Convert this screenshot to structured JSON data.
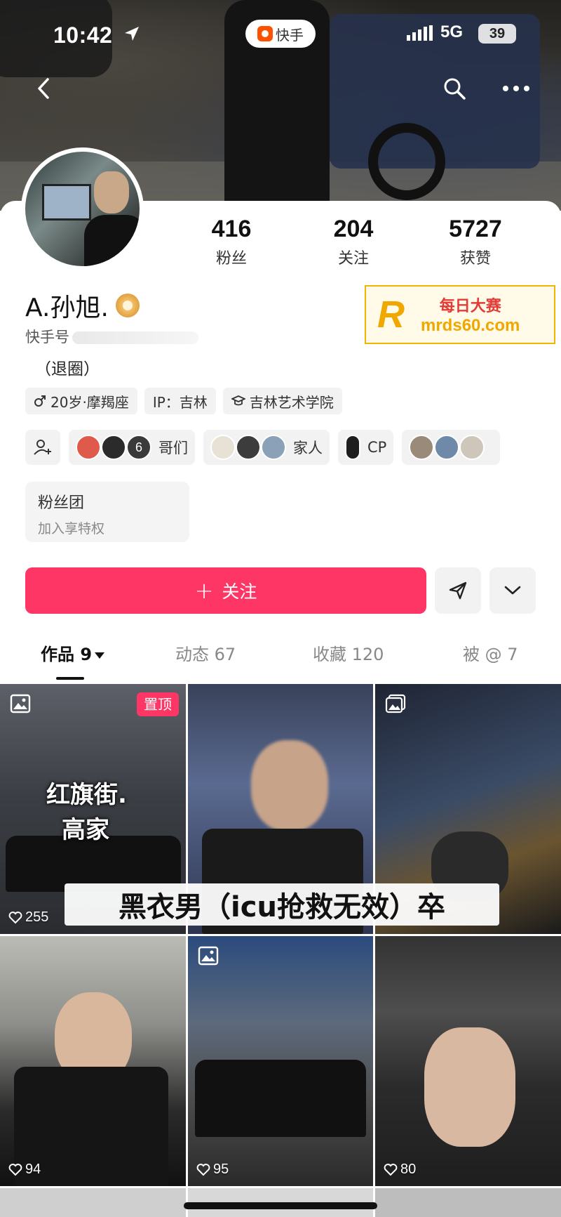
{
  "status_bar": {
    "time": "10:42",
    "app_pill": "快手",
    "network": "5G",
    "battery": "39"
  },
  "header": {
    "icons": [
      "back-icon",
      "search-icon",
      "more-icon"
    ]
  },
  "profile": {
    "name": "A.孙旭.",
    "kuaishou_id_label": "快手号",
    "bio": "（退圈）",
    "stats": [
      {
        "value": "416",
        "label": "粉丝"
      },
      {
        "value": "204",
        "label": "关注"
      },
      {
        "value": "5727",
        "label": "获赞"
      }
    ],
    "tags": {
      "age": "20岁·摩羯座",
      "ip": "IP：吉林",
      "school": "吉林艺术学院"
    },
    "groups": [
      {
        "count": "6",
        "label": "哥们"
      },
      {
        "label": "家人"
      },
      {
        "label": "CP"
      }
    ],
    "fanclub": {
      "title": "粉丝团",
      "subtitle": "加入享特权"
    }
  },
  "actions": {
    "follow_label": "关注",
    "follow_color": "#fe3666"
  },
  "tabs": [
    {
      "label": "作品 9",
      "active": true
    },
    {
      "label": "动态 67"
    },
    {
      "label": "收藏 120"
    },
    {
      "label": "被 @ 7"
    }
  ],
  "grid": {
    "pinned_label": "置顶",
    "tiles": [
      {
        "likes": "255",
        "overlay": [
          "红旗街.",
          "高家"
        ]
      },
      {
        "likes": ""
      },
      {
        "likes": ""
      },
      {
        "likes": "94"
      },
      {
        "likes": "95"
      },
      {
        "likes": "80"
      }
    ],
    "caption": "黑衣男（icu抢救无效）卒"
  },
  "watermark": {
    "logo_letter": "R",
    "line1": "每日大赛",
    "line2": "mrds60.com"
  }
}
